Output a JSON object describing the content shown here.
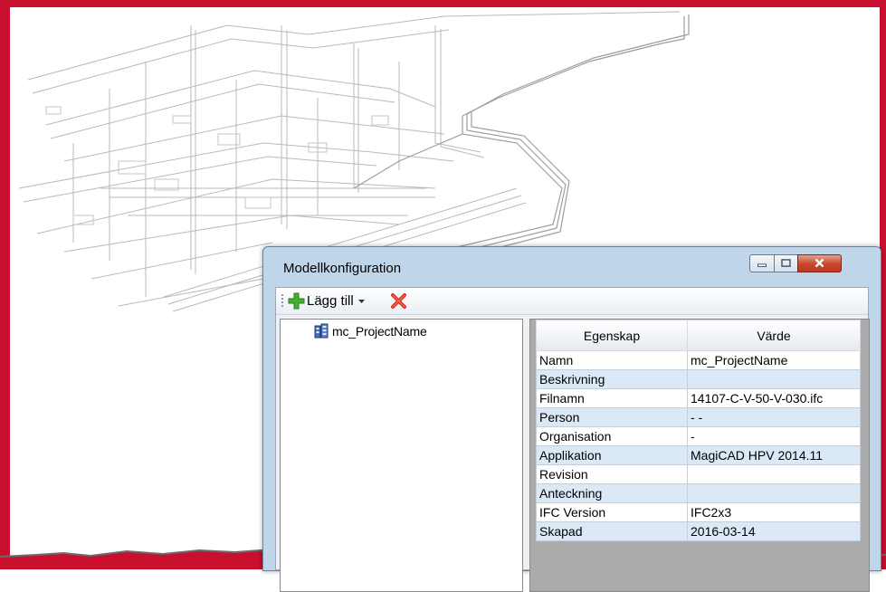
{
  "window": {
    "title": "Modellkonfiguration"
  },
  "toolbar": {
    "add_label": "Lägg till",
    "icons": {
      "add": "plus-icon",
      "dropdown": "caret-down-icon",
      "delete": "delete-x-icon"
    }
  },
  "tree": {
    "items": [
      {
        "label": "mc_ProjectName",
        "icon": "building-model-icon"
      }
    ]
  },
  "grid": {
    "columns": [
      "Egenskap",
      "Värde"
    ],
    "rows": [
      {
        "property": "Namn",
        "value": "mc_ProjectName"
      },
      {
        "property": "Beskrivning",
        "value": ""
      },
      {
        "property": "Filnamn",
        "value": "14107-C-V-50-V-030.ifc"
      },
      {
        "property": "Person",
        "value": "- -"
      },
      {
        "property": "Organisation",
        "value": "-"
      },
      {
        "property": "Applikation",
        "value": "MagiCAD HPV 2014.11"
      },
      {
        "property": "Revision",
        "value": ""
      },
      {
        "property": "Anteckning",
        "value": ""
      },
      {
        "property": "IFC Version",
        "value": "IFC2x3"
      },
      {
        "property": "Skapad",
        "value": "2016-03-14"
      }
    ]
  },
  "colors": {
    "frame": "#c8102e",
    "dialog_chrome": "#bfd5ea",
    "row_alt": "#dbe9f7",
    "close_button": "#c8452b"
  }
}
